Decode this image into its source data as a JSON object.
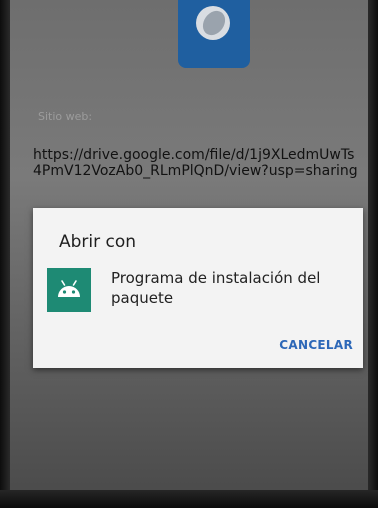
{
  "background": {
    "website_label": "Sitio web:",
    "url": "https://drive.google.com/file/d/1j9XLedmUwTs4PmV12VozAb0_RLmPlQnD/view?usp=sharing"
  },
  "dialog": {
    "title": "Abrir con",
    "option_label": "Programa de instalación del paquete",
    "option_icon": "android-icon",
    "cancel_label": "CANCELAR"
  },
  "colors": {
    "accent": "#2d68b8",
    "package_icon_bg": "#1e8a74",
    "app_icon_bg": "#1f5fa0",
    "dialog_bg": "#f3f3f3"
  }
}
